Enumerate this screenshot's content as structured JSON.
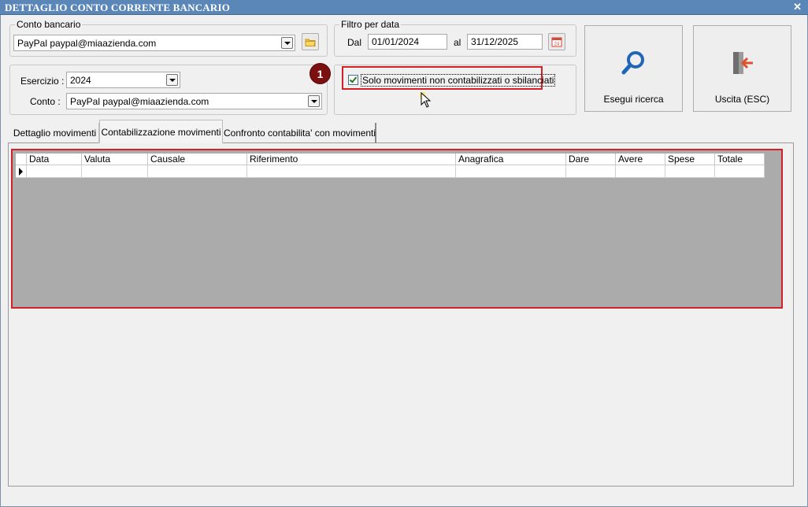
{
  "window": {
    "title": "DETTAGLIO CONTO CORRENTE BANCARIO",
    "close_icon": "close-icon"
  },
  "conto_bancario": {
    "legend": "Conto bancario",
    "value": "PayPal paypal@miaazienda.com"
  },
  "filtro_data": {
    "legend": "Filtro per data",
    "from_label": "Dal",
    "from_value": "01/01/2024",
    "to_label": "al",
    "to_value": "31/12/2025"
  },
  "esercizio": {
    "label": "Esercizio :",
    "value": "2024"
  },
  "conto": {
    "label": "Conto :",
    "value": "PayPal paypal@miaazienda.com"
  },
  "checkbox": {
    "label": "Solo movimenti non contabilizzati o sbilanciati",
    "checked": true
  },
  "badge": {
    "number": "1"
  },
  "buttons": {
    "search": "Esegui ricerca",
    "exit": "Uscita (ESC)"
  },
  "tabs": [
    {
      "label": "Dettaglio movimenti"
    },
    {
      "label": "Contabilizzazione movimenti",
      "active": true
    },
    {
      "label": "Confronto contabilita' con movimenti"
    }
  ],
  "grid": {
    "columns": [
      "Data",
      "Valuta",
      "Causale",
      "Riferimento",
      "Anagrafica",
      "Dare",
      "Avere",
      "Spese",
      "Totale"
    ]
  },
  "colors": {
    "highlight": "#d61f26",
    "titlebar": "#5b87b8",
    "badge": "#7a1010",
    "grid_bg": "#ababab"
  }
}
